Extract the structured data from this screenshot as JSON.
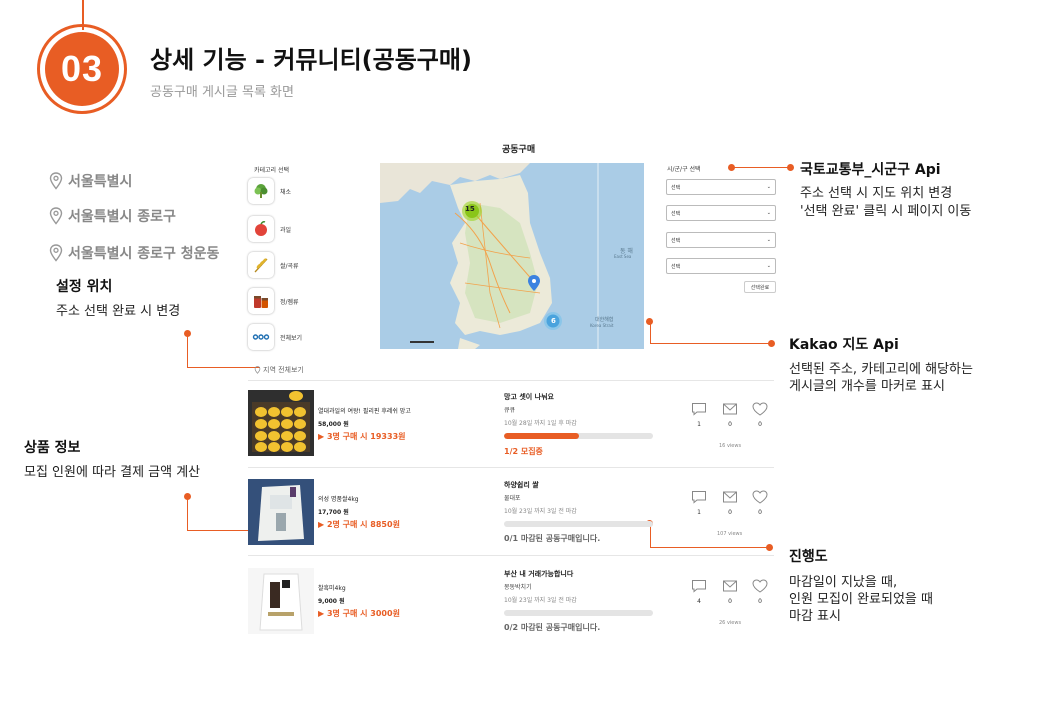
{
  "header": {
    "number": "03",
    "title": "상세 기능 - 커뮤니티(공동구매)",
    "subtitle": "공동구매 게시글 목록 화면"
  },
  "locations": [
    "서울특별시",
    "서울특별시 종로구",
    "서울특별시 종로구 청운동"
  ],
  "annotations": {
    "location": {
      "title": "설정 위치",
      "text": "주소 선택 완료 시 변경"
    },
    "product": {
      "title": "상품 정보",
      "text": "모집 인원에 따라 결제 금액 계산"
    },
    "region_api": {
      "title": "국토교통부_시군구 Api",
      "line1": "주소 선택 시 지도 위치 변경",
      "line2": "'선택 완료' 클릭 시 페이지 이동"
    },
    "kakao": {
      "title": "Kakao 지도 Api",
      "line1": "선택된 주소, 카테고리에 해당하는",
      "line2": "게시글의 개수를 마커로 표시"
    },
    "progress": {
      "title": "진행도",
      "line1": "마감일이 지났을 때,",
      "line2": "인원 모집이 완료되었을 때",
      "line3": "마감 표시"
    }
  },
  "screen": {
    "page_title": "공동구매",
    "category_label": "카테고리 선택",
    "categories": [
      "채소",
      "과일",
      "쌀/곡류",
      "정/젬류",
      "전체보기"
    ],
    "region_label": "시/군/구 선택",
    "selects": [
      "선택",
      "선택",
      "선택",
      "선택"
    ],
    "select_done": "선택완료",
    "region_all": "지역 전체보기",
    "map": {
      "cluster_1": "15",
      "cluster_2": "6",
      "sea_label": "동 해",
      "sea_sub": "East Sea",
      "strait_label": "대한해협",
      "strait_sub": "Korea Strait"
    }
  },
  "posts": [
    {
      "product_name": "열대과일의 여왕! 필리핀 후레쉬 망고",
      "price": "58,000 원",
      "offer": "▶ 3명 구매 시 19333원",
      "title": "망고 셋이 나눠요",
      "location": "큐큐",
      "date": "10월 28일 까지    1일 후 마감",
      "progress": 0.5,
      "status": "1/2 모집중",
      "comments": "1",
      "messages": "0",
      "likes": "0",
      "views": "16 views"
    },
    {
      "product_name": "의성 명품쌀4kg",
      "price": "17,700 원",
      "offer": "▶ 2명 구매 시 8850원",
      "title": "하양쉽리 쌀",
      "location": "물대포",
      "date": "10월 23일 까지    3일 전 마감",
      "progress": 0,
      "status": "0/1 마감된 공동구매입니다.",
      "comments": "1",
      "messages": "0",
      "likes": "0",
      "views": "107 views"
    },
    {
      "product_name": "찰흑미4kg",
      "price": "9,000 원",
      "offer": "▶ 3명 구매 시 3000원",
      "title": "부산 내 거래가능합니다",
      "location": "몽동박치기",
      "date": "10월 23일 까지    3일 전 마감",
      "progress": 0,
      "status": "0/2 마감된 공동구매입니다.",
      "comments": "4",
      "messages": "0",
      "likes": "0",
      "views": "26 views"
    }
  ],
  "colors": {
    "accent": "#e85d24",
    "closed_text": "#666666",
    "active_text": "#e85d24"
  }
}
